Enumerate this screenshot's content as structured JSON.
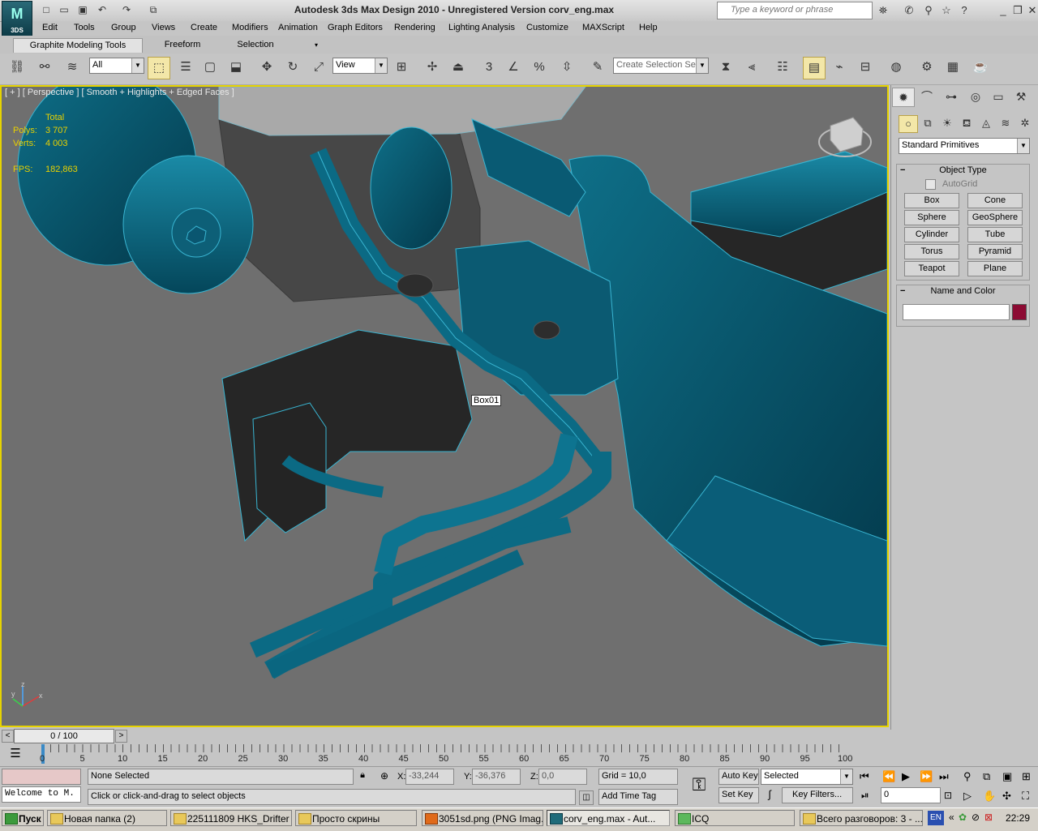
{
  "app": {
    "title": "Autodesk 3ds Max Design 2010  -  Unregistered Version     corv_eng.max",
    "logo": "3DS",
    "search_placeholder": "Type a keyword or phrase"
  },
  "menu": [
    "Edit",
    "Tools",
    "Group",
    "Views",
    "Create",
    "Modifiers",
    "Animation",
    "Graph Editors",
    "Rendering",
    "Lighting Analysis",
    "Customize",
    "MAXScript",
    "Help"
  ],
  "ribbon": {
    "tabs": [
      "Graphite Modeling Tools",
      "Freeform",
      "Selection"
    ]
  },
  "toolbar": {
    "filter": "All",
    "ref_coord": "View",
    "selection_set_placeholder": "Create Selection Se",
    "snap_3": "3",
    "snap_pct": "%"
  },
  "viewport": {
    "label": "[ + ] [ Perspective ] [ Smooth + Highlights + Edged Faces ]",
    "stats": {
      "total_label": "Total",
      "polys_label": "Polys:",
      "polys_value": "3 707",
      "verts_label": "Verts:",
      "verts_value": "4 003",
      "fps_label": "FPS:",
      "fps_value": "182,863"
    },
    "tooltip": "Box01",
    "axis": {
      "z": "z",
      "y": "y",
      "x": "x"
    }
  },
  "command_panel": {
    "category": "Standard Primitives",
    "object_type_title": "Object Type",
    "autogrid_label": "AutoGrid",
    "object_buttons": [
      "Box",
      "Cone",
      "Sphere",
      "GeoSphere",
      "Cylinder",
      "Tube",
      "Torus",
      "Pyramid",
      "Teapot",
      "Plane"
    ],
    "name_color_title": "Name and Color",
    "object_color": "#8c0b33"
  },
  "timeline": {
    "slider_label": "0 / 100",
    "ticks": [
      "0",
      "5",
      "10",
      "15",
      "20",
      "25",
      "30",
      "35",
      "40",
      "45",
      "50",
      "55",
      "60",
      "65",
      "70",
      "75",
      "80",
      "85",
      "90",
      "95",
      "100"
    ]
  },
  "status": {
    "welcome": "Welcome to M.",
    "selection": "None Selected",
    "prompt": "Click or click-and-drag to select objects",
    "x_label": "X:",
    "x_value": "-33,244",
    "y_label": "Y:",
    "y_value": "-36,376",
    "z_label": "Z:",
    "z_value": "0,0",
    "grid": "Grid = 10,0",
    "add_time_tag": "Add Time Tag",
    "auto_key": "Auto Key",
    "set_key": "Set Key",
    "key_mode": "Selected",
    "key_filters": "Key Filters...",
    "frame": "0"
  },
  "taskbar": {
    "start": "Пуск",
    "tasks": [
      "Новая папка (2)",
      "225111809 HKS_Drifter",
      "Просто скрины",
      "3051sd.png (PNG Imag...",
      "corv_eng.max - Aut...",
      "ICQ",
      "Всего разговоров: 3 - ..."
    ],
    "lang": "EN",
    "clock": "22:29"
  }
}
